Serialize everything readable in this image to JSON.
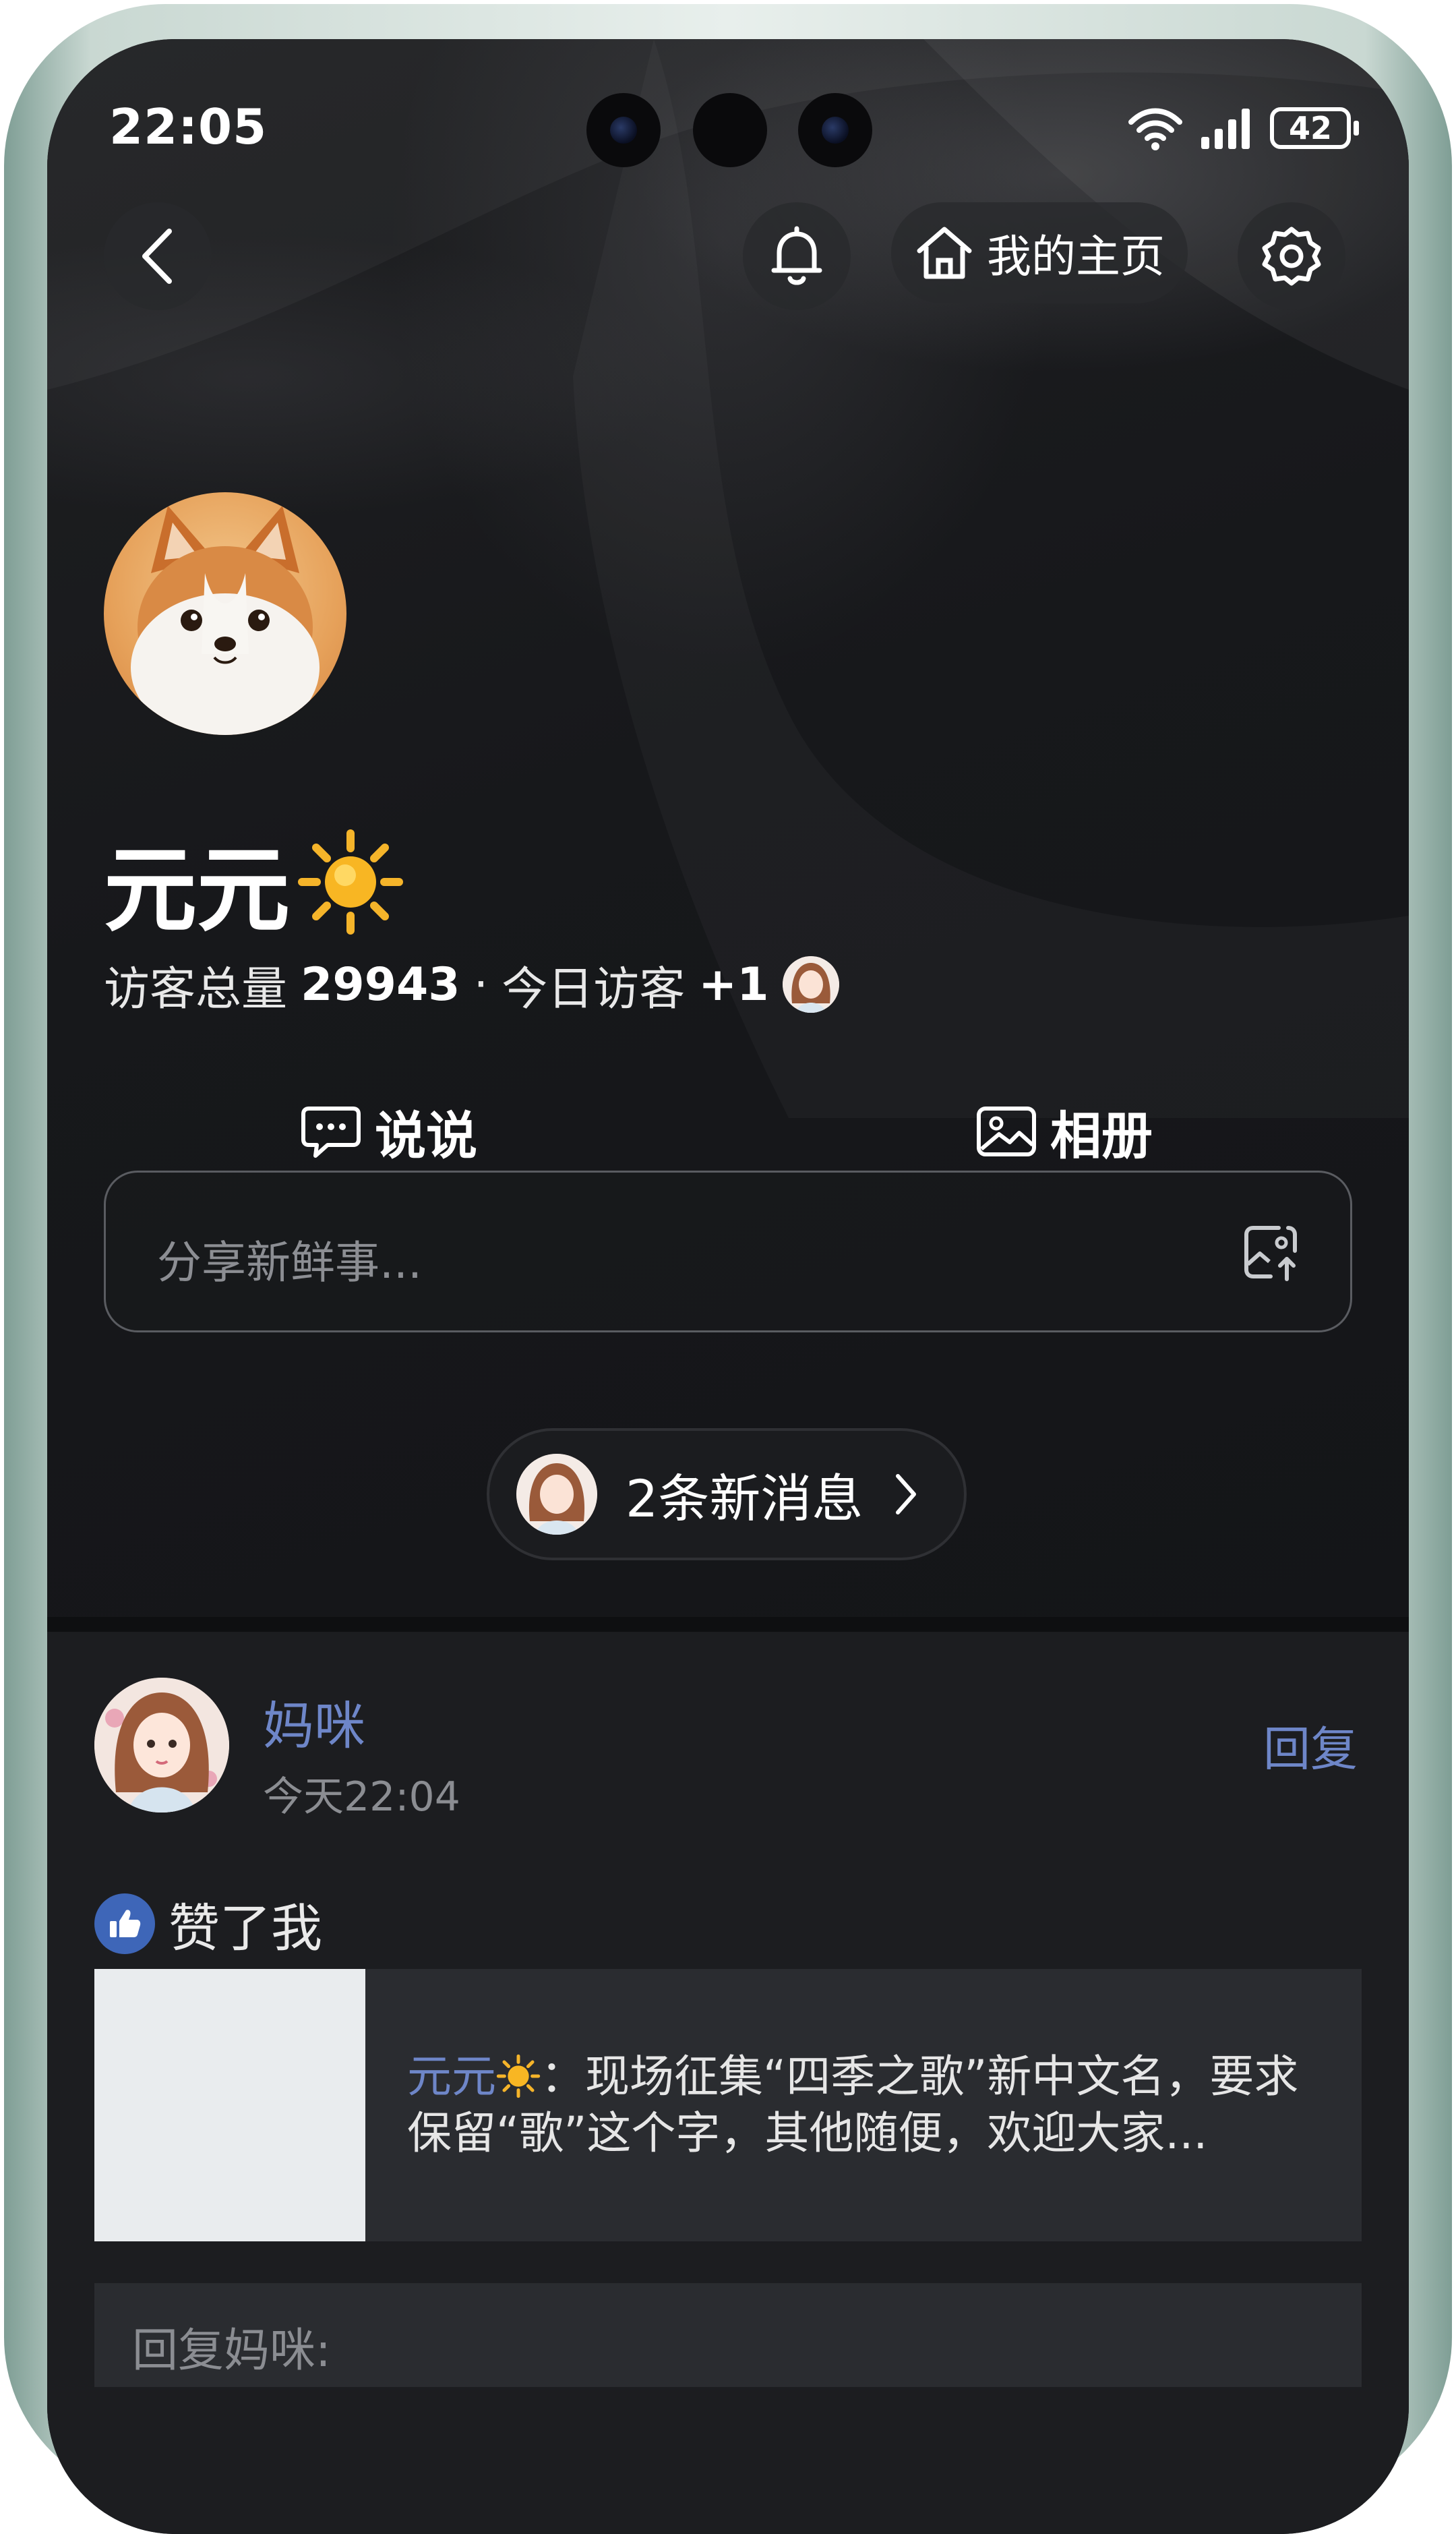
{
  "status_bar": {
    "time": "22:05",
    "battery": "42"
  },
  "top_bar": {
    "home_label": "我的主页"
  },
  "profile": {
    "name": "元元",
    "name_emoji": "☀️",
    "visitors_label": "访客总量",
    "visitors_total": "29943",
    "separator": "·",
    "today_label": "今日访客",
    "today_count": "+1"
  },
  "tabs": [
    {
      "label": "说说",
      "icon": "chat-bubble-icon"
    },
    {
      "label": "相册",
      "icon": "photo-icon"
    }
  ],
  "composer": {
    "placeholder": "分享新鲜事..."
  },
  "notice": {
    "label": "2条新消息"
  },
  "feed": {
    "item": {
      "user": "妈咪",
      "time": "今天22:04",
      "reply_action": "回复",
      "action_text": "赞了我",
      "quote_author": "元元",
      "quote_author_emoji": "☀️",
      "quote_colon": "：",
      "quote_text": "现场征集“四季之歌”新中文名，要求保留“歌”这个字，其他随便，欢迎大家...",
      "reply_placeholder": "回复妈咪:"
    }
  },
  "colors": {
    "accent_link": "#6e86c8",
    "like_badge": "#3e66b8",
    "background": "#141518"
  }
}
